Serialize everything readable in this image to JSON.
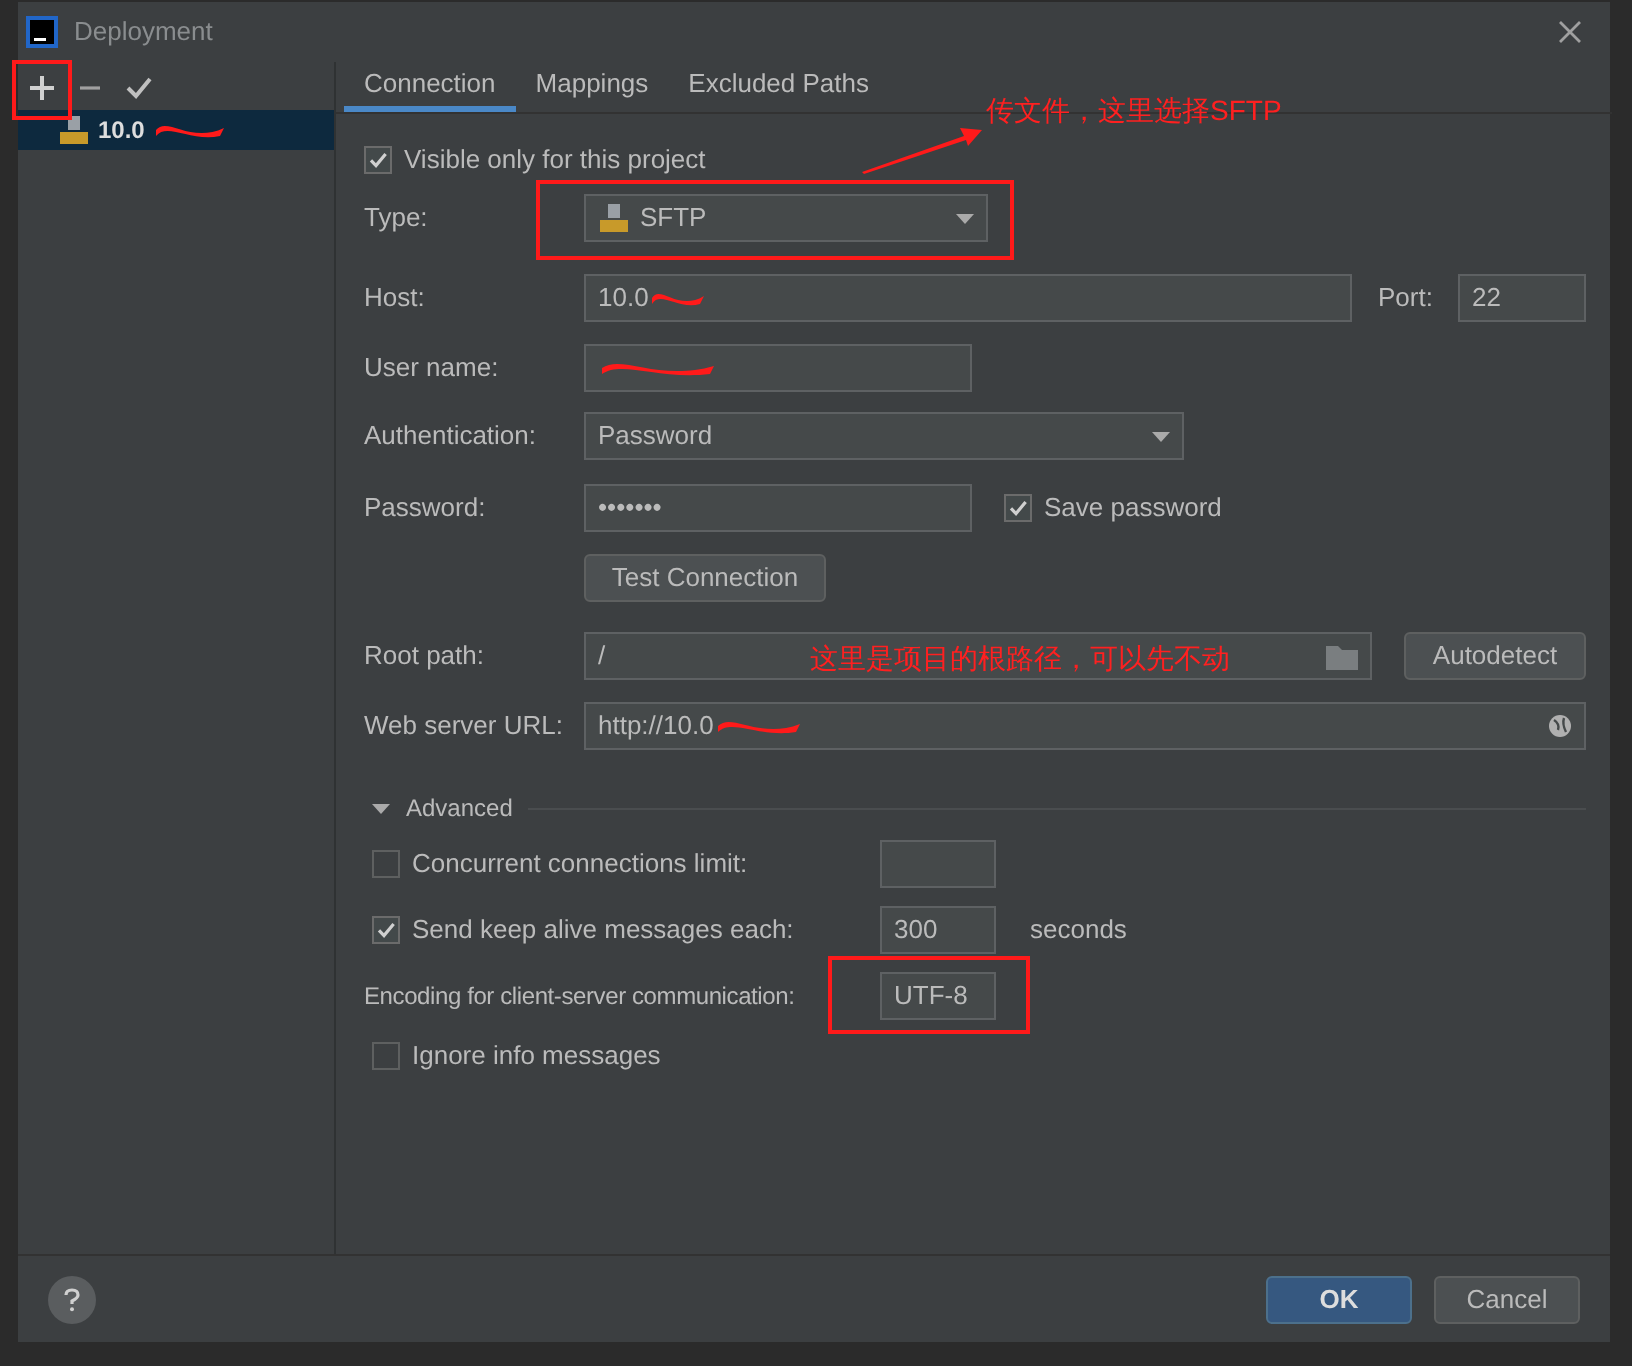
{
  "window": {
    "title": "Deployment"
  },
  "servers": [
    {
      "label": "10.0",
      "selected": true
    }
  ],
  "tabs": [
    {
      "label": "Connection",
      "selected": true
    },
    {
      "label": "Mappings",
      "selected": false
    },
    {
      "label": "Excluded Paths",
      "selected": false
    }
  ],
  "visible_only": {
    "label": "Visible only for this project",
    "checked": true
  },
  "type": {
    "label": "Type:",
    "value": "SFTP"
  },
  "host": {
    "label": "Host:",
    "value": "10.0"
  },
  "port": {
    "label": "Port:",
    "value": "22"
  },
  "user_name": {
    "label": "User name:"
  },
  "authentication": {
    "label": "Authentication:",
    "value": "Password"
  },
  "password": {
    "label": "Password:",
    "value": "•••••••"
  },
  "save_password": {
    "label": "Save password",
    "checked": true
  },
  "test_button": "Test Connection",
  "root_path": {
    "label": "Root path:",
    "value": "/"
  },
  "autodetect_button": "Autodetect",
  "web_server_url": {
    "label": "Web server URL:",
    "value": "http://10.0"
  },
  "advanced": {
    "label": "Advanced",
    "expanded": true
  },
  "concurrent_limit": {
    "label": "Concurrent connections limit:",
    "checked": false
  },
  "keep_alive": {
    "label": "Send keep alive messages each:",
    "checked": true,
    "value": "300",
    "unit": "seconds"
  },
  "encoding": {
    "label": "Encoding for client-server communication:",
    "value": "UTF-8"
  },
  "ignore_info": {
    "label": "Ignore info messages",
    "checked": false
  },
  "buttons": [
    {
      "label": "OK",
      "kind": "primary"
    },
    {
      "label": "Cancel",
      "kind": "secondary"
    }
  ],
  "annotations": [
    {
      "text": "传文件，这里选择SFTP"
    },
    {
      "text": "这里是项目的根路径，可以先不动"
    }
  ]
}
